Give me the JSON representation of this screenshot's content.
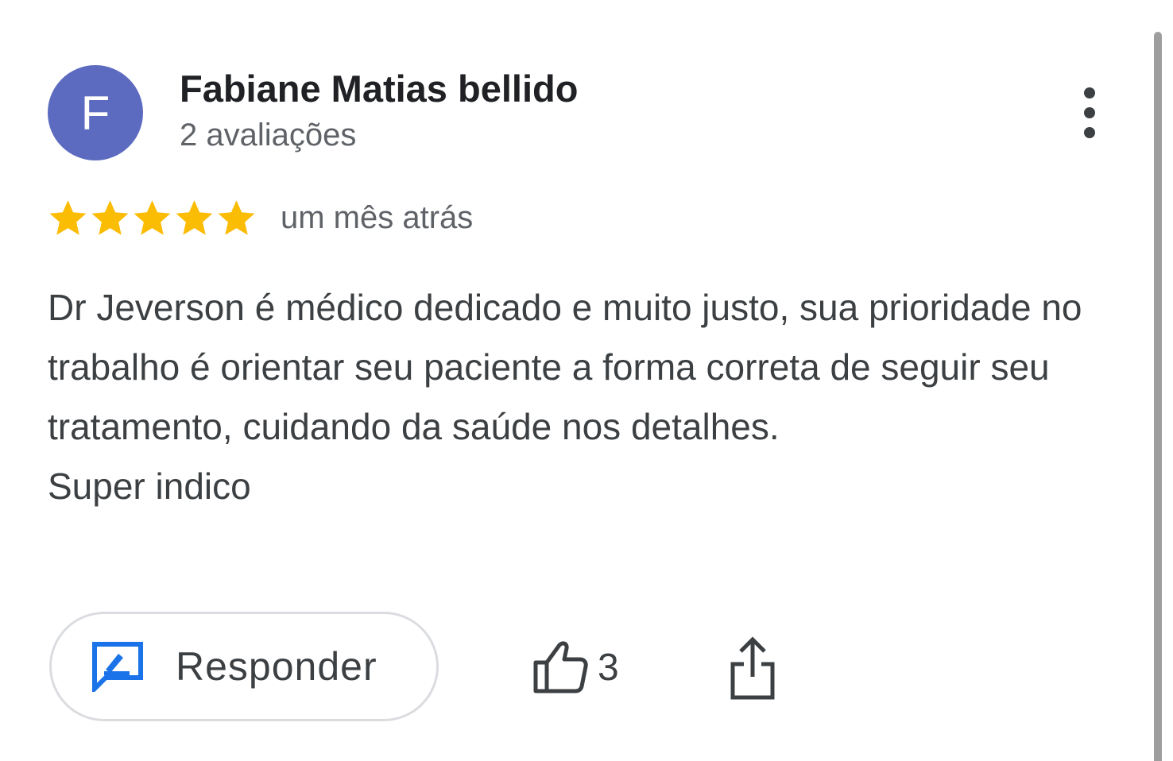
{
  "review": {
    "author": {
      "initial": "F",
      "name": "Fabiane Matias bellido",
      "review_count": "2 avaliações",
      "avatar_color": "#5c6bc0"
    },
    "rating": 5,
    "max_rating": 5,
    "star_color": "#fbbc04",
    "timestamp": "um mês atrás",
    "body": [
      "Dr Jeverson é médico dedicado e muito justo, sua prioridade no trabalho é orientar seu paciente a forma correta de seguir seu tratamento, cuidando da saúde nos detalhes.",
      "Super indico"
    ],
    "actions": {
      "reply_label": "Responder",
      "reply_icon": "reply-edit-icon",
      "like_icon": "thumbs-up-icon",
      "like_count": "3",
      "share_icon": "share-icon",
      "more_icon": "more-vert-icon"
    },
    "accent_color": "#1a73e8"
  }
}
